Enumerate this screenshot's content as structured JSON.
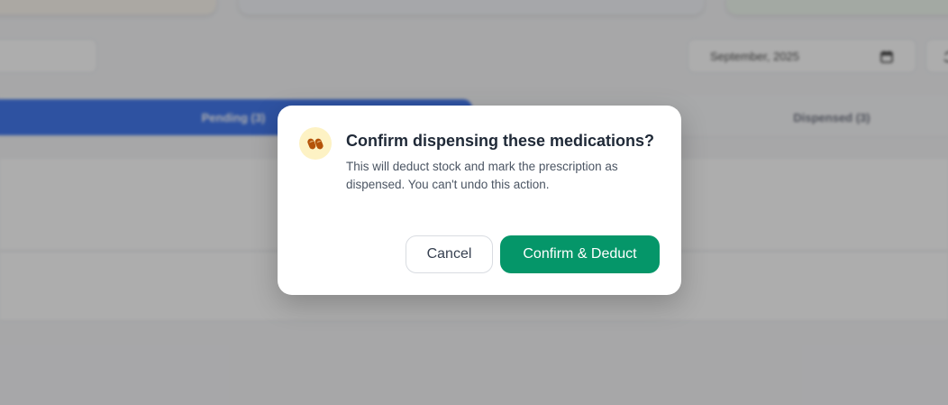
{
  "background": {
    "date_filter": {
      "value": "September, 2025",
      "icon": "calendar-icon"
    },
    "reset_icon": "refresh-icon",
    "tabs": [
      {
        "label": "Pending (3)",
        "active": true
      },
      {
        "label": "Dispensed (3)",
        "active": false
      }
    ]
  },
  "dialog": {
    "icon": "pills-icon",
    "title": "Confirm dispensing these medications?",
    "message": "This will deduct stock and mark the prescription as dispensed. You can't undo this action.",
    "cancel_label": "Cancel",
    "confirm_label": "Confirm & Deduct"
  },
  "colors": {
    "accent_tab": "#2563eb",
    "confirm_button": "#059669",
    "icon_bg": "#fdf2c4",
    "icon_fg": "#b45309"
  }
}
